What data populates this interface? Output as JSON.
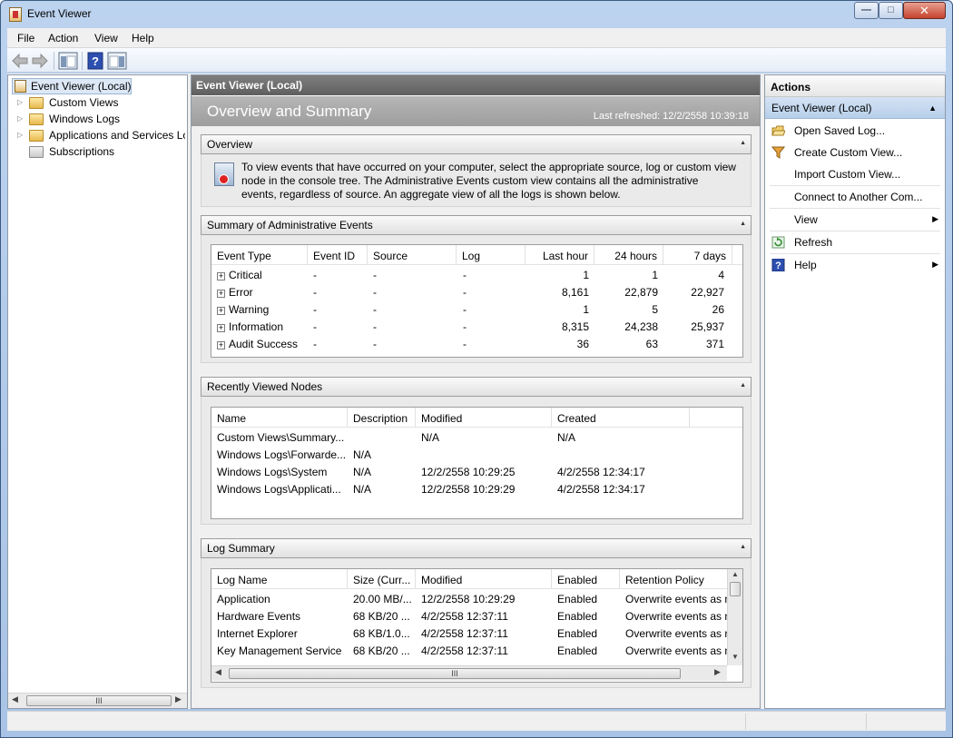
{
  "window": {
    "title": "Event Viewer",
    "controls": {
      "minimize": "—",
      "maximize": "□",
      "close": "✕"
    }
  },
  "menu": [
    "File",
    "Action",
    "View",
    "Help"
  ],
  "toolbar": {
    "icons": [
      "back-arrow-icon",
      "forward-arrow-icon",
      "console-tree-icon",
      "help-icon",
      "action-pane-icon"
    ]
  },
  "tree": {
    "items": [
      {
        "label": "Event Viewer (Local)",
        "icon": "event-viewer-icon"
      },
      {
        "label": "Custom Views",
        "icon": "folder-icon"
      },
      {
        "label": "Windows Logs",
        "icon": "folder-icon"
      },
      {
        "label": "Applications and Services Lo",
        "icon": "folder-icon"
      },
      {
        "label": "Subscriptions",
        "icon": "subscriptions-icon"
      }
    ],
    "scroll_grip": "III"
  },
  "center": {
    "header": "Event Viewer (Local)",
    "overview_title": "Overview and Summary",
    "last_refreshed": "Last refreshed: 12/2/2558 10:39:18",
    "overview": {
      "title": "Overview",
      "text": "To view events that have occurred on your computer, select the appropriate source, log or custom view node in the console tree. The Administrative Events custom view contains all the administrative events, regardless of source. An aggregate view of all the logs is shown below."
    },
    "summary": {
      "title": "Summary of Administrative Events",
      "columns": [
        "Event Type",
        "Event ID",
        "Source",
        "Log",
        "Last hour",
        "24 hours",
        "7 days"
      ],
      "rows": [
        {
          "type": "Critical",
          "id": "-",
          "source": "-",
          "log": "-",
          "hour": "1",
          "day": "1",
          "week": "4"
        },
        {
          "type": "Error",
          "id": "-",
          "source": "-",
          "log": "-",
          "hour": "8,161",
          "day": "22,879",
          "week": "22,927"
        },
        {
          "type": "Warning",
          "id": "-",
          "source": "-",
          "log": "-",
          "hour": "1",
          "day": "5",
          "week": "26"
        },
        {
          "type": "Information",
          "id": "-",
          "source": "-",
          "log": "-",
          "hour": "8,315",
          "day": "24,238",
          "week": "25,937"
        },
        {
          "type": "Audit Success",
          "id": "-",
          "source": "-",
          "log": "-",
          "hour": "36",
          "day": "63",
          "week": "371"
        }
      ]
    },
    "recent": {
      "title": "Recently Viewed Nodes",
      "columns": [
        "Name",
        "Description",
        "Modified",
        "Created"
      ],
      "rows": [
        {
          "name": "Custom Views\\Summary...",
          "desc": "",
          "modified": "N/A",
          "created": "N/A"
        },
        {
          "name": "Windows Logs\\Forwarde...",
          "desc": "N/A",
          "modified": "",
          "created": ""
        },
        {
          "name": "Windows Logs\\System",
          "desc": "N/A",
          "modified": "12/2/2558 10:29:25",
          "created": "4/2/2558 12:34:17"
        },
        {
          "name": "Windows Logs\\Applicati...",
          "desc": "N/A",
          "modified": "12/2/2558 10:29:29",
          "created": "4/2/2558 12:34:17"
        }
      ]
    },
    "logsummary": {
      "title": "Log Summary",
      "columns": [
        "Log Name",
        "Size (Curr...",
        "Modified",
        "Enabled",
        "Retention Policy"
      ],
      "rows": [
        {
          "name": "Application",
          "size": "20.00 MB/...",
          "modified": "12/2/2558 10:29:29",
          "enabled": "Enabled",
          "retention": "Overwrite events as n"
        },
        {
          "name": "Hardware Events",
          "size": "68 KB/20 ...",
          "modified": "4/2/2558 12:37:11",
          "enabled": "Enabled",
          "retention": "Overwrite events as n"
        },
        {
          "name": "Internet Explorer",
          "size": "68 KB/1.0...",
          "modified": "4/2/2558 12:37:11",
          "enabled": "Enabled",
          "retention": "Overwrite events as n"
        },
        {
          "name": "Key Management Service",
          "size": "68 KB/20 ...",
          "modified": "4/2/2558 12:37:11",
          "enabled": "Enabled",
          "retention": "Overwrite events as n"
        }
      ],
      "scroll_grip": "III"
    }
  },
  "actions": {
    "header": "Actions",
    "section": "Event Viewer (Local)",
    "items": [
      {
        "label": "Open Saved Log...",
        "icon": "open-log-icon"
      },
      {
        "label": "Create Custom View...",
        "icon": "filter-icon"
      },
      {
        "label": "Import Custom View...",
        "icon": ""
      },
      {
        "label": "Connect to Another Com...",
        "icon": ""
      },
      {
        "label": "View",
        "icon": "",
        "submenu": true
      },
      {
        "label": "Refresh",
        "icon": "refresh-icon"
      },
      {
        "label": "Help",
        "icon": "help-icon",
        "submenu": true
      }
    ]
  }
}
